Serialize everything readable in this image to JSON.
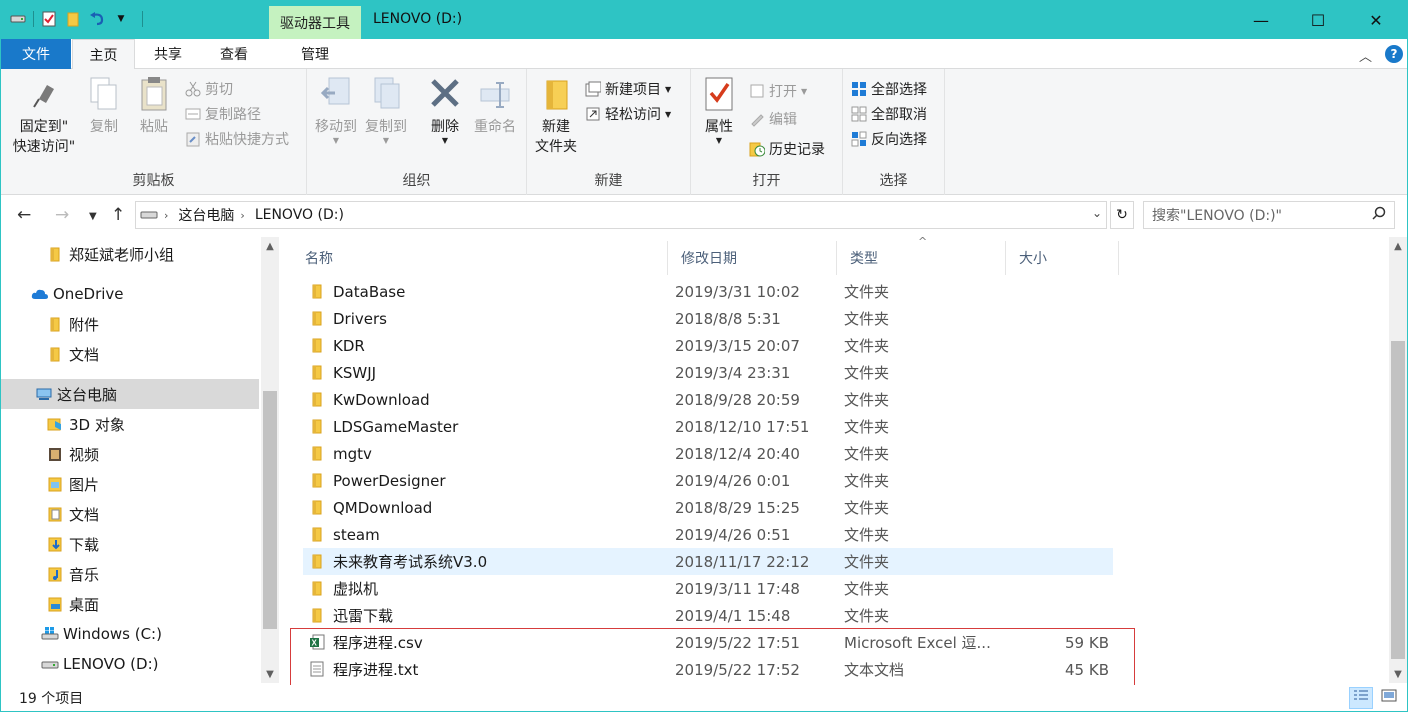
{
  "window": {
    "title": "LENOVO (D:)",
    "context_tab": "驱动器工具",
    "minimize": "—",
    "maximize": "☐",
    "close": "✕"
  },
  "tabs": {
    "file": "文件",
    "home": "主页",
    "share": "共享",
    "view": "查看",
    "manage": "管理"
  },
  "ribbon": {
    "clipboard": {
      "label": "剪贴板",
      "pin_line1": "固定到\"",
      "pin_line2": "快速访问\"",
      "copy": "复制",
      "paste": "粘贴",
      "cut": "剪切",
      "copy_path": "复制路径",
      "paste_shortcut": "粘贴快捷方式"
    },
    "organize": {
      "label": "组织",
      "move_to": "移动到",
      "copy_to": "复制到",
      "delete": "删除",
      "rename": "重命名"
    },
    "new": {
      "label": "新建",
      "new_folder_line1": "新建",
      "new_folder_line2": "文件夹",
      "new_item": "新建项目",
      "easy_access": "轻松访问"
    },
    "open": {
      "label": "打开",
      "properties": "属性",
      "open": "打开",
      "edit": "编辑",
      "history": "历史记录"
    },
    "select": {
      "label": "选择",
      "select_all": "全部选择",
      "select_none": "全部取消",
      "invert": "反向选择"
    }
  },
  "address": {
    "crumbs": [
      "这台电脑",
      "LENOVO (D:)"
    ],
    "search_placeholder": "搜索\"LENOVO (D:)\""
  },
  "nav": [
    {
      "label": "郑延斌老师小组",
      "icon": "folder-icon"
    },
    {
      "label": "OneDrive",
      "icon": "cloud-icon"
    },
    {
      "label": "附件",
      "icon": "folder-icon"
    },
    {
      "label": "文档",
      "icon": "folder-icon"
    },
    {
      "label": "这台电脑",
      "icon": "computer-icon"
    },
    {
      "label": "3D 对象",
      "icon": "3d-objects-icon"
    },
    {
      "label": "视频",
      "icon": "video-icon"
    },
    {
      "label": "图片",
      "icon": "pictures-icon"
    },
    {
      "label": "文档",
      "icon": "documents-icon"
    },
    {
      "label": "下载",
      "icon": "downloads-icon"
    },
    {
      "label": "音乐",
      "icon": "music-icon"
    },
    {
      "label": "桌面",
      "icon": "desktop-icon"
    },
    {
      "label": "Windows (C:)",
      "icon": "windows-drive-icon"
    },
    {
      "label": "LENOVO (D:)",
      "icon": "drive-icon"
    }
  ],
  "columns": {
    "name": "名称",
    "date": "修改日期",
    "type": "类型",
    "size": "大小",
    "sort_indicator": "^"
  },
  "files": [
    {
      "name": "DataBase",
      "date": "2019/3/31 10:02",
      "type": "文件夹",
      "size": "",
      "icon": "folder-icon"
    },
    {
      "name": "Drivers",
      "date": "2018/8/8 5:31",
      "type": "文件夹",
      "size": "",
      "icon": "folder-icon"
    },
    {
      "name": "KDR",
      "date": "2019/3/15 20:07",
      "type": "文件夹",
      "size": "",
      "icon": "folder-icon"
    },
    {
      "name": "KSWJJ",
      "date": "2019/3/4 23:31",
      "type": "文件夹",
      "size": "",
      "icon": "folder-icon"
    },
    {
      "name": "KwDownload",
      "date": "2018/9/28 20:59",
      "type": "文件夹",
      "size": "",
      "icon": "folder-icon"
    },
    {
      "name": "LDSGameMaster",
      "date": "2018/12/10 17:51",
      "type": "文件夹",
      "size": "",
      "icon": "folder-icon"
    },
    {
      "name": "mgtv",
      "date": "2018/12/4 20:40",
      "type": "文件夹",
      "size": "",
      "icon": "folder-icon"
    },
    {
      "name": "PowerDesigner",
      "date": "2019/4/26 0:01",
      "type": "文件夹",
      "size": "",
      "icon": "folder-icon"
    },
    {
      "name": "QMDownload",
      "date": "2018/8/29 15:25",
      "type": "文件夹",
      "size": "",
      "icon": "folder-icon"
    },
    {
      "name": "steam",
      "date": "2019/4/26 0:51",
      "type": "文件夹",
      "size": "",
      "icon": "folder-icon"
    },
    {
      "name": "未来教育考试系统V3.0",
      "date": "2018/11/17 22:12",
      "type": "文件夹",
      "size": "",
      "icon": "folder-icon"
    },
    {
      "name": "虚拟机",
      "date": "2019/3/11 17:48",
      "type": "文件夹",
      "size": "",
      "icon": "folder-icon"
    },
    {
      "name": "迅雷下载",
      "date": "2019/4/1 15:48",
      "type": "文件夹",
      "size": "",
      "icon": "folder-icon"
    },
    {
      "name": "程序进程.csv",
      "date": "2019/5/22 17:51",
      "type": "Microsoft Excel 逗...",
      "size": "59 KB",
      "icon": "excel-file-icon"
    },
    {
      "name": "程序进程.txt",
      "date": "2019/5/22 17:52",
      "type": "文本文档",
      "size": "45 KB",
      "icon": "text-file-icon"
    }
  ],
  "status": {
    "count": "19 个项目"
  },
  "colors": {
    "titlebar": "#2ec4c4",
    "file_tab": "#1979ca",
    "context_tab": "#c5f2c0",
    "hover_row": "#e5f3ff",
    "annotation_box": "#d63c3c"
  }
}
